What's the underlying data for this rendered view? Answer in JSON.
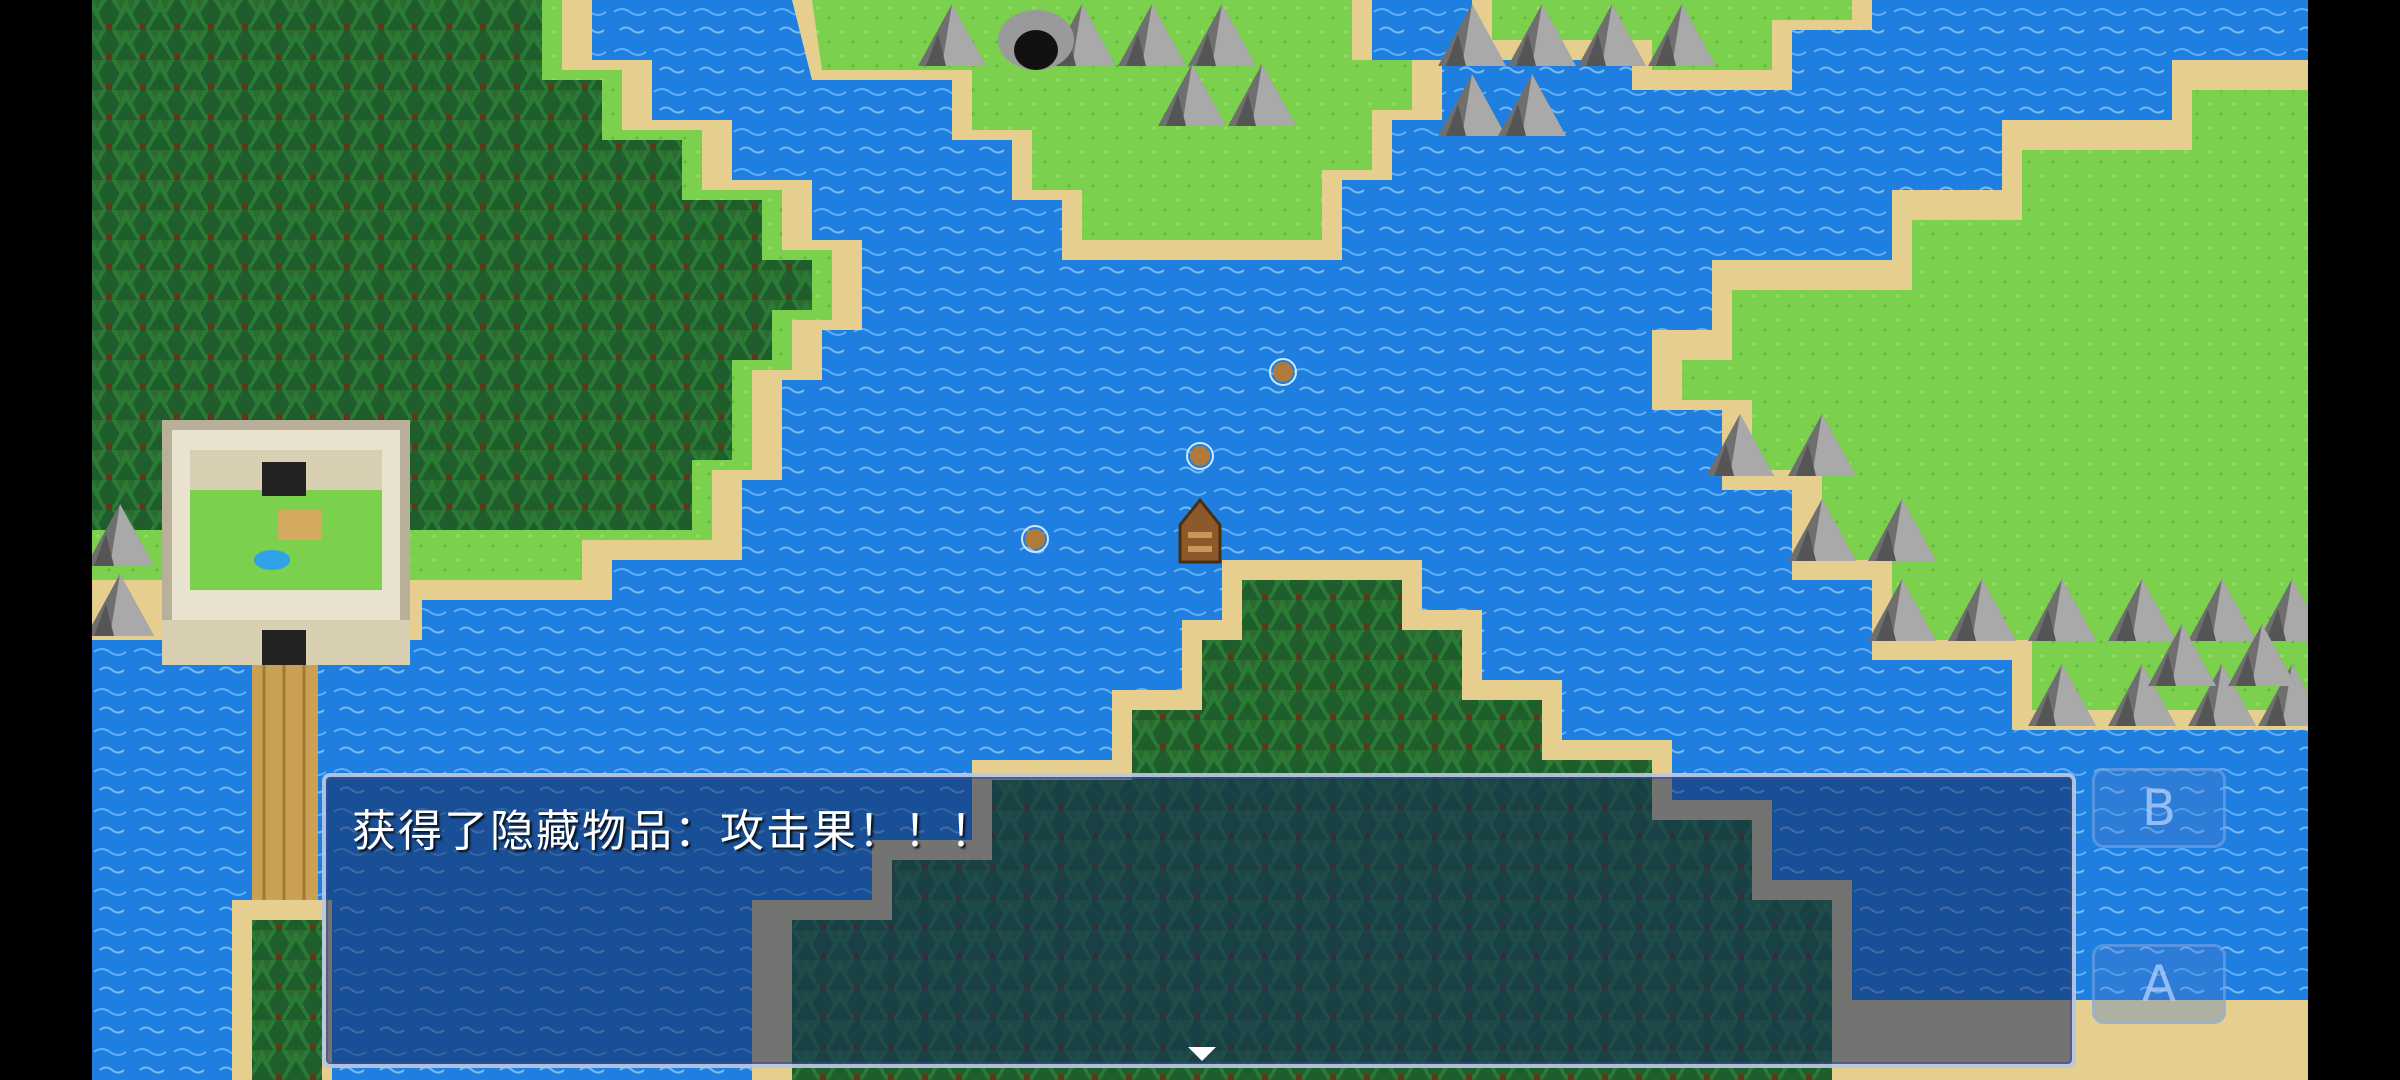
{
  "dialog": {
    "message": "获得了隐藏物品：攻击果！！！",
    "continue_icon": "down-triangle-icon"
  },
  "controls": {
    "b_label": "B",
    "a_label": "A"
  },
  "colors": {
    "water": "#1f7fe0",
    "grass": "#7bd04d",
    "sand": "#e6cf8e",
    "forest": "#1f5e2c",
    "rock": "#8d8d8d",
    "dialog_bg": "rgba(20,40,90,0.55)"
  }
}
